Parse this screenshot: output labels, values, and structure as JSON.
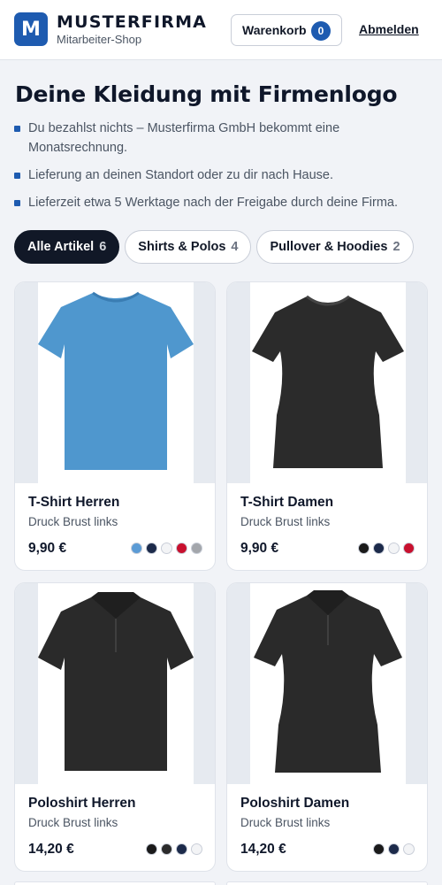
{
  "header": {
    "logo_letter": "M",
    "brand_name": "MUSTERFIRMA",
    "brand_sub": "Mitarbeiter-Shop",
    "cart_label": "Warenkorb",
    "cart_count": "0",
    "logout_label": "Abmelden",
    "accent_color": "#1e5bb0"
  },
  "page": {
    "title": "Deine Kleidung mit Firmenlogo",
    "bullets": [
      "Du bezahlst nichts – Musterfirma GmbH bekommt eine Monatsrechnung.",
      "Lieferung an deinen Standort oder zu dir nach Hause.",
      "Lieferzeit etwa 5 Werktage nach der Freigabe durch deine Firma."
    ]
  },
  "filters": [
    {
      "label": "Alle Artikel",
      "count": "6",
      "active": true
    },
    {
      "label": "Shirts & Polos",
      "count": "4",
      "active": false
    },
    {
      "label": "Pullover & Hoodies",
      "count": "2",
      "active": false
    }
  ],
  "products": [
    {
      "name": "T-Shirt Herren",
      "print": "Druck Brust links",
      "price": "9,90 €",
      "garment_color": "#4f97ce",
      "garment": "tshirt-men-icon",
      "colors": [
        "#5b9bd5",
        "#1c2a4a",
        "#f3f4f6",
        "#c8102e",
        "#a3a6ab"
      ]
    },
    {
      "name": "T-Shirt Damen",
      "print": "Druck Brust links",
      "price": "9,90 €",
      "garment_color": "#2b2b2b",
      "garment": "tshirt-women-icon",
      "colors": [
        "#1a1a1a",
        "#1c2a4a",
        "#f3f4f6",
        "#c8102e"
      ]
    },
    {
      "name": "Poloshirt Herren",
      "print": "Druck Brust links",
      "price": "14,20 €",
      "garment_color": "#2a2a2a",
      "garment": "polo-men-icon",
      "colors": [
        "#1a1a1a",
        "#2b2b2b",
        "#1c2a4a",
        "#f3f4f6"
      ]
    },
    {
      "name": "Poloshirt Damen",
      "print": "Druck Brust links",
      "price": "14,20 €",
      "garment_color": "#2a2a2a",
      "garment": "polo-women-icon",
      "colors": [
        "#1a1a1a",
        "#1c2a4a",
        "#f3f4f6"
      ]
    }
  ]
}
